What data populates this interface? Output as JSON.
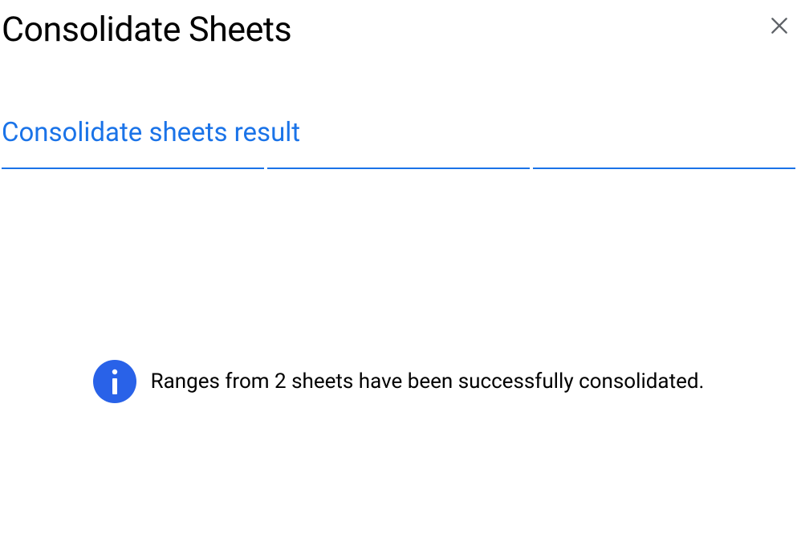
{
  "header": {
    "title": "Consolidate Sheets"
  },
  "result": {
    "heading": "Consolidate sheets result"
  },
  "message": {
    "text": "Ranges from 2 sheets have been successfully consolidated."
  }
}
